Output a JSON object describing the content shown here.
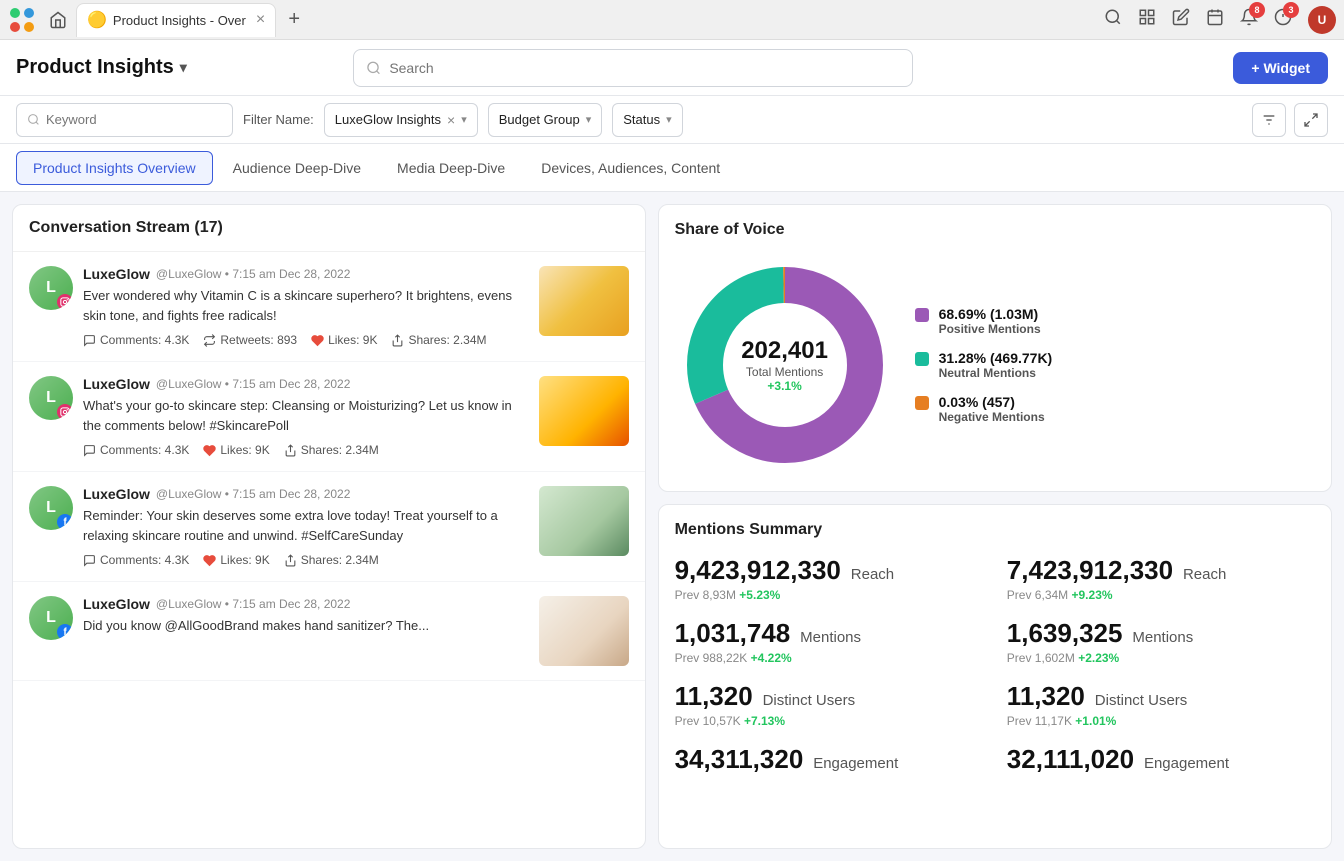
{
  "browser": {
    "tab_label": "Product Insights - Over",
    "new_tab_icon": "+",
    "home_icon": "⌂",
    "search_icon": "🔍",
    "grid_icon": "⊞",
    "edit_icon": "✏",
    "calendar_icon": "📅",
    "notif_icon": "🔔",
    "notif_badge": "8",
    "alert_badge": "3",
    "avatar_initials": "U"
  },
  "header": {
    "title": "Product Insights",
    "chevron": "▾",
    "search_placeholder": "Search",
    "widget_btn": "+ Widget"
  },
  "filters": {
    "keyword_placeholder": "Keyword",
    "filter_name_label": "Filter Name:",
    "filter_name_value": "LuxeGlow Insights",
    "budget_group": "Budget Group",
    "status": "Status"
  },
  "tabs": [
    {
      "label": "Product Insights Overview",
      "active": true
    },
    {
      "label": "Audience Deep-Dive",
      "active": false
    },
    {
      "label": "Media Deep-Dive",
      "active": false
    },
    {
      "label": "Devices, Audiences, Content",
      "active": false
    }
  ],
  "conversation_stream": {
    "title": "Conversation Stream",
    "count": 17,
    "posts": [
      {
        "name": "LuxeGlow",
        "handle": "@LuxeGlow",
        "time": "7:15 am Dec 28, 2022",
        "text": "Ever wondered why Vitamin C is a skincare superhero? It brightens, evens skin tone, and fights free radicals!",
        "comments": "Comments: 4.3K",
        "retweets": "Retweets: 893",
        "likes": "Likes: 9K",
        "shares": "Shares: 2.34M",
        "platform": "instagram",
        "image_class": "img-citrus"
      },
      {
        "name": "LuxeGlow",
        "handle": "@LuxeGlow",
        "time": "7:15 am Dec 28, 2022",
        "text": "What's your go-to skincare step: Cleansing or Moisturizing? Let us know in the comments below! #SkincarePoll",
        "comments": "Comments: 4.3K",
        "likes": "Likes: 9K",
        "shares": "Shares: 2.34M",
        "platform": "instagram",
        "image_class": "img-sunflower"
      },
      {
        "name": "LuxeGlow",
        "handle": "@LuxeGlow",
        "time": "7:15 am Dec 28, 2022",
        "text": "Reminder: Your skin deserves some extra love today! Treat yourself to a relaxing skincare routine and unwind. #SelfCareSunday",
        "comments": "Comments: 4.3K",
        "likes": "Likes: 9K",
        "shares": "Shares: 2.34M",
        "platform": "facebook",
        "image_class": "img-spa"
      },
      {
        "name": "LuxeGlow",
        "handle": "@LuxeGlow",
        "time": "7:15 am Dec 28, 2022",
        "text": "Did you know @AllGoodBrand makes hand sanitizer? The...",
        "platform": "facebook",
        "image_class": "img-cream"
      }
    ]
  },
  "share_of_voice": {
    "title": "Share of Voice",
    "total": "202,401",
    "total_label": "Total Mentions",
    "change": "+3.1%",
    "segments": [
      {
        "label": "Positive Mentions",
        "pct": "68.69% (1.03M)",
        "color": "#9b59b6",
        "value": 68.69
      },
      {
        "label": "Neutral Mentions",
        "pct": "31.28% (469.77K)",
        "color": "#1abc9c",
        "value": 31.28
      },
      {
        "label": "Negative Mentions",
        "pct": "0.03% (457)",
        "color": "#e67e22",
        "value": 0.03
      }
    ]
  },
  "mentions_summary": {
    "title": "Mentions Summary",
    "metrics": [
      {
        "value": "9,423,912,330",
        "suffix": "Reach",
        "prev": "Prev 8,93M",
        "change": "+5.23%",
        "positive": true
      },
      {
        "value": "7,423,912,330",
        "suffix": "Reach",
        "prev": "Prev 6,34M",
        "change": "+9.23%",
        "positive": true
      },
      {
        "value": "1,031,748",
        "suffix": "Mentions",
        "prev": "Prev 988,22K",
        "change": "+4.22%",
        "positive": true
      },
      {
        "value": "1,639,325",
        "suffix": "Mentions",
        "prev": "Prev 1,602M",
        "change": "+2.23%",
        "positive": true
      },
      {
        "value": "11,320",
        "suffix": "Distinct Users",
        "prev": "Prev 10,57K",
        "change": "+7.13%",
        "positive": true
      },
      {
        "value": "11,320",
        "suffix": "Distinct Users",
        "prev": "Prev 11,17K",
        "change": "+1.01%",
        "positive": true
      },
      {
        "value": "34,311,320",
        "suffix": "Engagement",
        "prev": "",
        "change": "",
        "positive": true
      },
      {
        "value": "32,111,020",
        "suffix": "Engagement",
        "prev": "",
        "change": "",
        "positive": true
      }
    ]
  }
}
